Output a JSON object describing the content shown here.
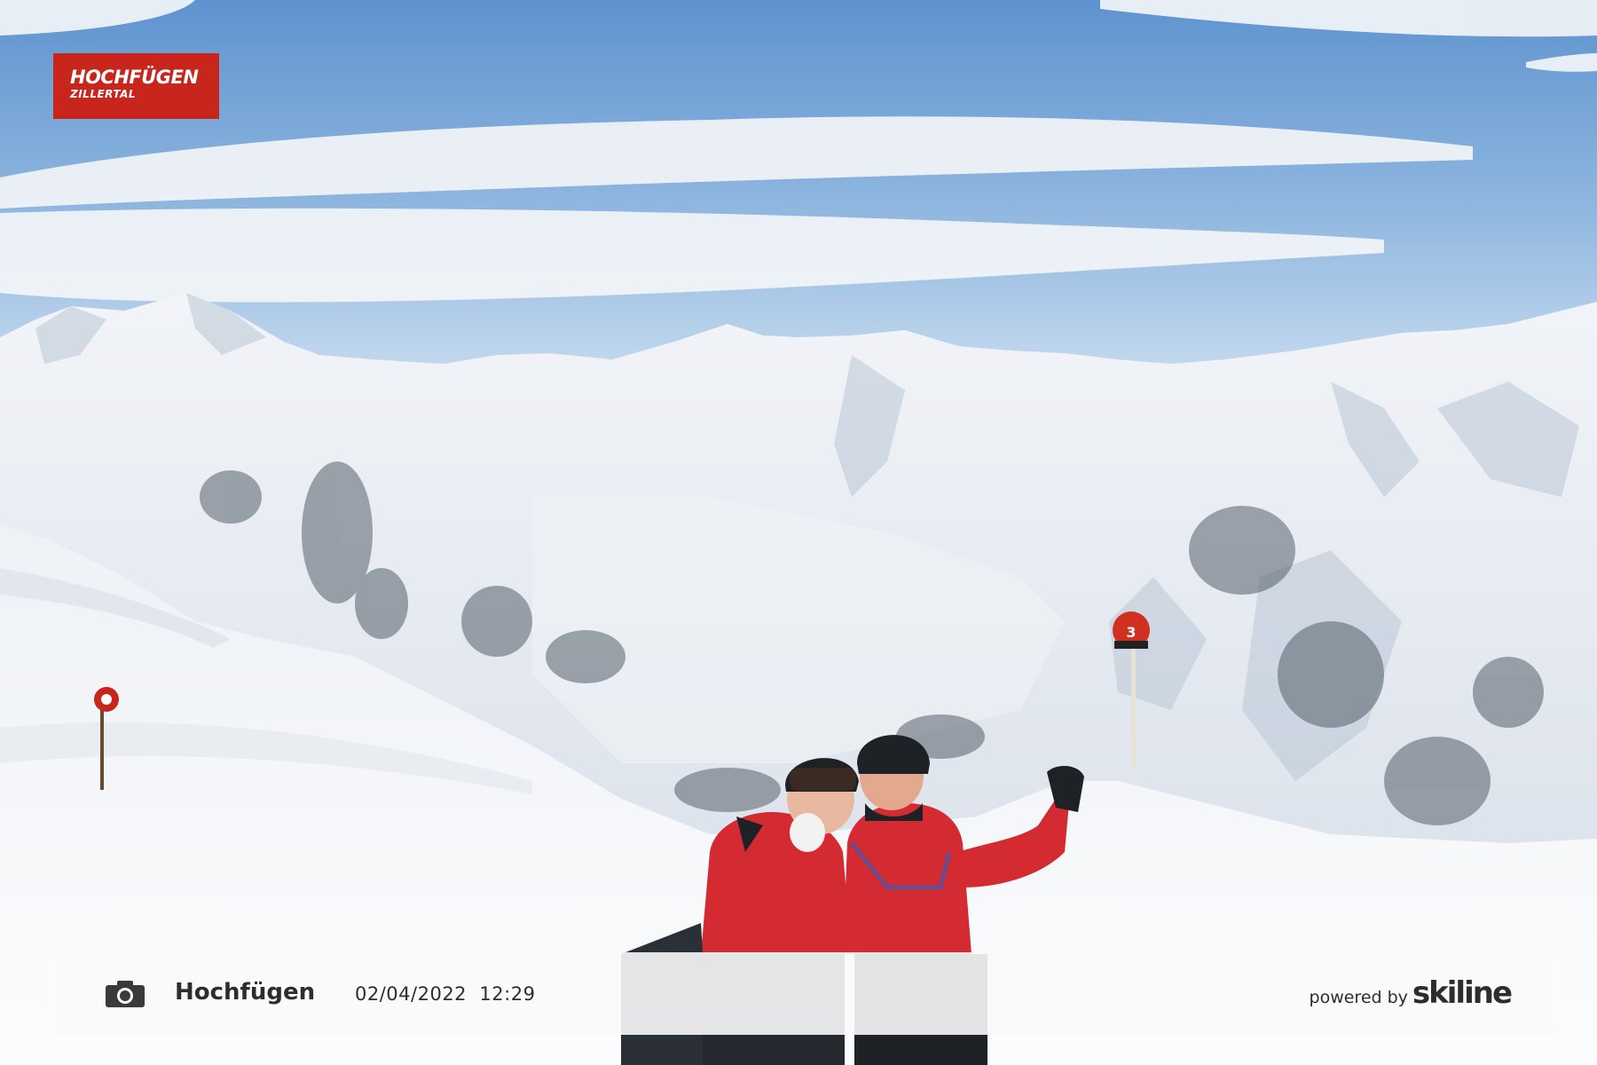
{
  "logo": {
    "line1": "HOCHFÜGEN",
    "line2": "ZILLERTAL",
    "color": "#c8251d"
  },
  "caption": {
    "camera_icon": "camera-icon",
    "location": "Hochfügen",
    "date": "02/04/2022",
    "time": "12:29",
    "powered_by": "powered by",
    "brand": "skiline"
  },
  "scene": {
    "slope_marker_right": "3"
  },
  "colors": {
    "sky": "#6fa0d6",
    "snow": "#f4f6f9",
    "jacket": "#d42a32"
  }
}
